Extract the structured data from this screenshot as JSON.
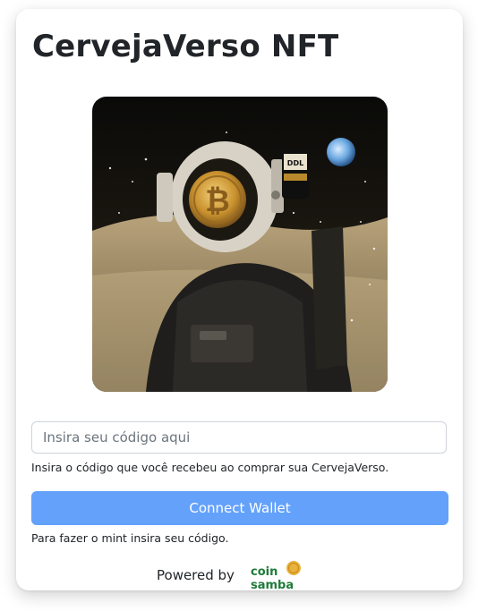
{
  "card": {
    "title": "CervejaVerso NFT"
  },
  "artwork": {
    "icon": "astronaut-nft-image"
  },
  "code_field": {
    "value": "",
    "placeholder": "Insira seu código aqui",
    "help": "Insira o código que você recebeu ao comprar sua CervejaVerso."
  },
  "connect": {
    "label": "Connect Wallet",
    "help": "Para fazer o mint insira seu código."
  },
  "footer": {
    "powered_by": "Powered by",
    "logo_top": "coin",
    "logo_bottom": "samba"
  },
  "colors": {
    "button": "#63a1fb",
    "brand_green": "#1f7a3a",
    "brand_gold": "#e9b23c"
  }
}
